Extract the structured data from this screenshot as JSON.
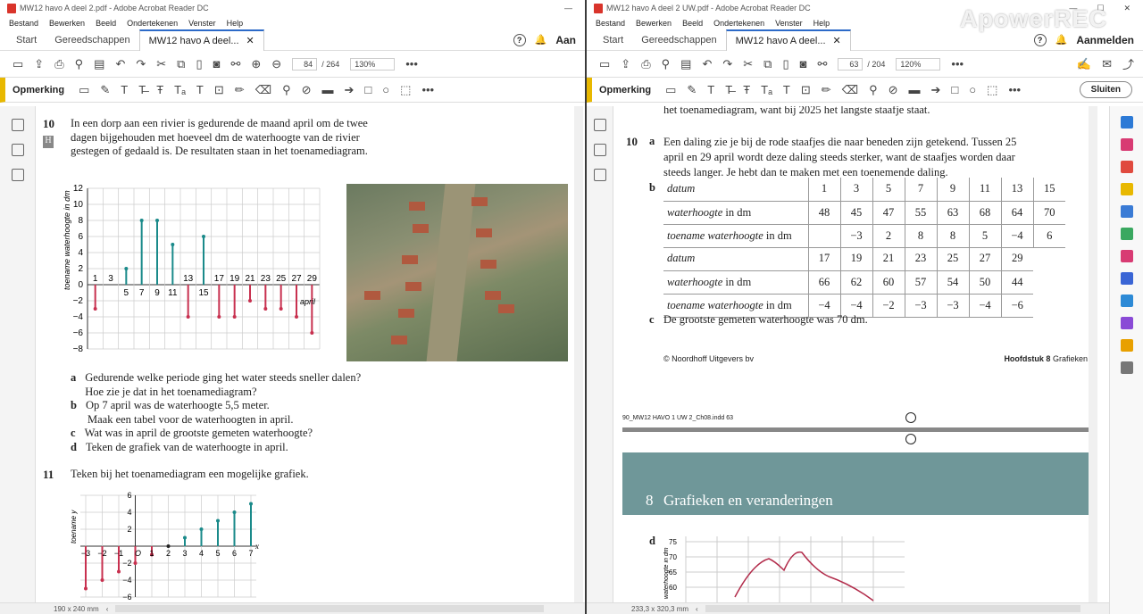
{
  "left_window": {
    "title": "MW12 havo A deel 2.pdf - Adobe Acrobat Reader DC",
    "menu": [
      "Bestand",
      "Bewerken",
      "Beeld",
      "Ondertekenen",
      "Venster",
      "Help"
    ],
    "tabs": [
      "Start",
      "Gereedschappen",
      "MW12 havo A deel..."
    ],
    "signin": "Aan",
    "page_current": "84",
    "page_total": "/ 264",
    "zoom": "130%",
    "comment_label": "Opmerking",
    "status_size": "190 x 240 mm",
    "q10_num": "10",
    "q10_badge": "H",
    "q10_text": "In een dorp aan een rivier is gedurende de maand april om de twee dagen bijgehouden met hoeveel dm de waterhoogte van de rivier gestegen of gedaald is. De resultaten staan in het toenamediagram.",
    "q10_items": [
      {
        "letter": "a",
        "text": "Gedurende welke periode ging het water steeds sneller dalen? Hoe zie je dat in het toenamediagram?"
      },
      {
        "letter": "b",
        "text": "Op 7 april was de waterhoogte 5,5 meter."
      },
      {
        "letter": "",
        "text": "Maak een tabel voor de waterhoogten in april."
      },
      {
        "letter": "c",
        "text": "Wat was in april de grootste gemeten waterhoogte?"
      },
      {
        "letter": "d",
        "text": "Teken de grafiek van de waterhoogte in april."
      }
    ],
    "q11_num": "11",
    "q11_text": "Teken bij het toenamediagram een mogelijke grafiek."
  },
  "right_window": {
    "title": "MW12 havo A deel 2 UW.pdf - Adobe Acrobat Reader DC",
    "watermark": "ApowerREC",
    "menu": [
      "Bestand",
      "Bewerken",
      "Beeld",
      "Ondertekenen",
      "Venster",
      "Help"
    ],
    "tabs": [
      "Start",
      "Gereedschappen",
      "MW12 havo A deel..."
    ],
    "signin": "Aanmelden",
    "page_current": "63",
    "page_total": "/ 204",
    "zoom": "120%",
    "comment_label": "Opmerking",
    "close_label": "Sluiten",
    "status_size": "233,3 x 320,3 mm",
    "top_line": "het toenamediagram, want bij 2025 het langste staafje staat.",
    "q10_num": "10",
    "q10a_letter": "a",
    "q10a_text": "Een daling zie je bij de rode staafjes die naar beneden zijn getekend. Tussen 25 april en 29 april wordt deze daling steeds sterker, want de staafjes worden daar steeds langer. Je hebt dan te maken met een toenemende daling.",
    "q10b_letter": "b",
    "table1": {
      "rows": [
        {
          "label": "datum",
          "values": [
            "1",
            "3",
            "5",
            "7",
            "9",
            "11",
            "13",
            "15"
          ]
        },
        {
          "label": "waterhoogte in dm",
          "values": [
            "48",
            "45",
            "47",
            "55",
            "63",
            "68",
            "64",
            "70"
          ]
        },
        {
          "label": "toename waterhoogte in dm",
          "values": [
            "",
            "−3",
            "2",
            "8",
            "8",
            "5",
            "−4",
            "6"
          ]
        }
      ]
    },
    "table2": {
      "rows": [
        {
          "label": "datum",
          "values": [
            "17",
            "19",
            "21",
            "23",
            "25",
            "27",
            "29"
          ]
        },
        {
          "label": "waterhoogte in dm",
          "values": [
            "66",
            "62",
            "60",
            "57",
            "54",
            "50",
            "44"
          ]
        },
        {
          "label": "toename waterhoogte in dm",
          "values": [
            "−4",
            "−4",
            "−2",
            "−3",
            "−3",
            "−4",
            "−6"
          ]
        }
      ]
    },
    "q10c_letter": "c",
    "q10c_text": "De grootste gemeten waterhoogte was 70 dm.",
    "footer_left": "© Noordhoff Uitgevers bv",
    "footer_right_bold": "Hoofdstuk 8",
    "footer_right": "Grafieken",
    "indd_line": "90_MW12 HAVO 1 UW 2_Ch08.indd   63",
    "banner_num": "8",
    "banner_title": "Grafieken en veranderingen",
    "q10d_letter": "d",
    "mini_yticks": [
      "75",
      "70",
      "65",
      "60"
    ],
    "mini_ylabel": "waterhoogte in dm"
  },
  "chart_data": [
    {
      "type": "bar",
      "ylabel": "toename waterhoogte in dm",
      "xlabel": "april",
      "categories": [
        "1",
        "3",
        "5",
        "7",
        "9",
        "11",
        "13",
        "15",
        "17",
        "19",
        "21",
        "23",
        "25",
        "27",
        "29"
      ],
      "values": [
        -3,
        0,
        2,
        8,
        8,
        5,
        -4,
        6,
        -4,
        -4,
        -2,
        -3,
        -3,
        -4,
        -6
      ],
      "ylim": [
        -8,
        12
      ],
      "yticks": [
        "12",
        "10",
        "8",
        "6",
        "4",
        "2",
        "0",
        "−2",
        "−4",
        "−6",
        "−8"
      ]
    },
    {
      "type": "bar",
      "ylabel": "toename y",
      "xlabel": "x",
      "categories": [
        "−3",
        "−2",
        "−1",
        "0",
        "1",
        "2",
        "3",
        "4",
        "5",
        "6",
        "7"
      ],
      "values": [
        -5,
        -4,
        -3,
        -2,
        -1,
        0,
        1,
        2,
        3,
        4,
        5
      ],
      "ylim": [
        -6,
        6
      ],
      "yticks": [
        "6",
        "4",
        "2",
        "−2",
        "−4",
        "−6"
      ],
      "origin_label": "O"
    }
  ]
}
